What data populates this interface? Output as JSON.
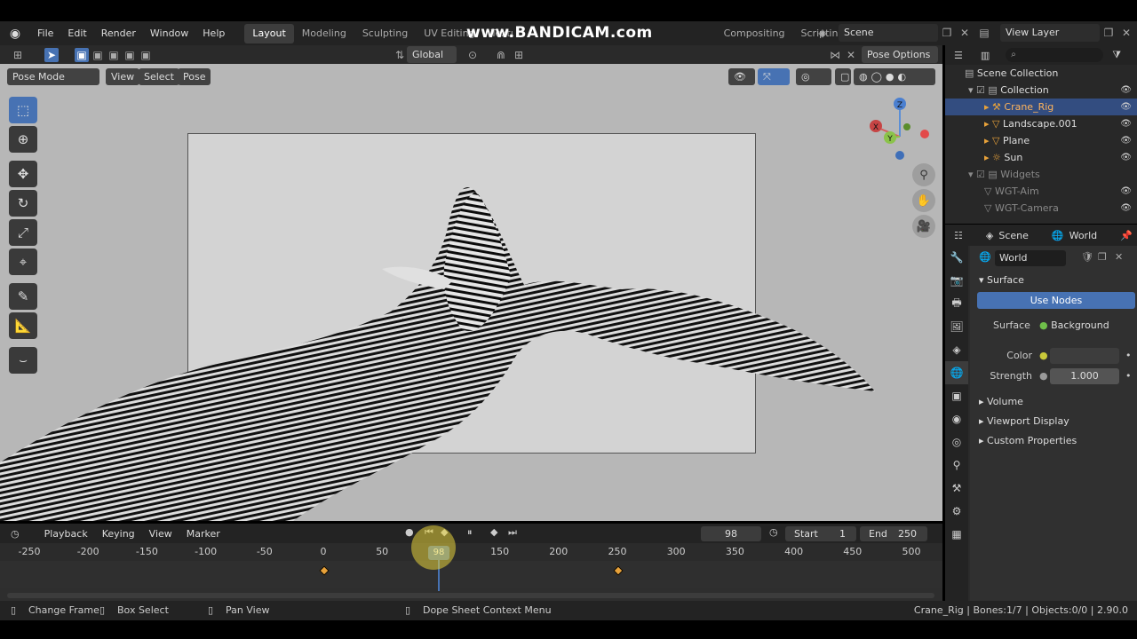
{
  "topbar": {
    "menus": [
      "File",
      "Edit",
      "Render",
      "Window",
      "Help"
    ],
    "workspaces": [
      "Layout",
      "Modeling",
      "Sculpting",
      "UV Editing",
      "Texture",
      "Compositing",
      "Scripting"
    ],
    "active_workspace": "Layout",
    "add_tab": "+",
    "watermark": "www.BANDICAM.com",
    "scene_name": "Scene",
    "view_layer": "View Layer"
  },
  "viewport": {
    "mode": "Pose Mode",
    "menus": [
      "View",
      "Select",
      "Pose"
    ],
    "orientation": "Global",
    "pose_options": "Pose Options",
    "gizmo_labels": {
      "z": "Z",
      "y": "Y",
      "x": "X"
    }
  },
  "outliner": {
    "search_placeholder": "",
    "rows": [
      {
        "label": "Scene Collection",
        "indent": 0
      },
      {
        "label": "Collection",
        "indent": 1
      },
      {
        "label": "Crane_Rig",
        "indent": 2,
        "selected": true
      },
      {
        "label": "Landscape.001",
        "indent": 2
      },
      {
        "label": "Plane",
        "indent": 2
      },
      {
        "label": "Sun",
        "indent": 2
      },
      {
        "label": "Widgets",
        "indent": 1,
        "dim": true
      },
      {
        "label": "WGT-Aim",
        "indent": 2,
        "dim": true
      },
      {
        "label": "WGT-Camera",
        "indent": 2,
        "dim": true
      }
    ]
  },
  "properties": {
    "scene_label": "Scene",
    "world_label": "World",
    "world_name": "World",
    "surface_panel": "Surface",
    "use_nodes": "Use Nodes",
    "surface_label": "Surface",
    "surface_value": "Background",
    "color_label": "Color",
    "strength_label": "Strength",
    "strength_value": "1.000",
    "panels": [
      "Volume",
      "Viewport Display",
      "Custom Properties"
    ]
  },
  "timeline": {
    "menus": [
      "Playback",
      "Keying",
      "View",
      "Marker"
    ],
    "current_frame": "98",
    "start_label": "Start",
    "start_value": "1",
    "end_label": "End",
    "end_value": "250",
    "ticks": [
      "-250",
      "-200",
      "-150",
      "-100",
      "-50",
      "0",
      "50",
      "100",
      "150",
      "200",
      "250",
      "300",
      "350",
      "400",
      "450",
      "500"
    ],
    "playhead_label": "98"
  },
  "statusbar": {
    "change_frame": "Change Frame",
    "box_select": "Box Select",
    "pan_view": "Pan View",
    "context_menu": "Dope Sheet Context Menu",
    "stats": "Crane_Rig | Bones:1/7 | Objects:0/0 | 2.90.0"
  },
  "colors": {
    "accent": "#4772b3",
    "keyframe": "#e8a23a",
    "selected_row": "#334d80"
  }
}
